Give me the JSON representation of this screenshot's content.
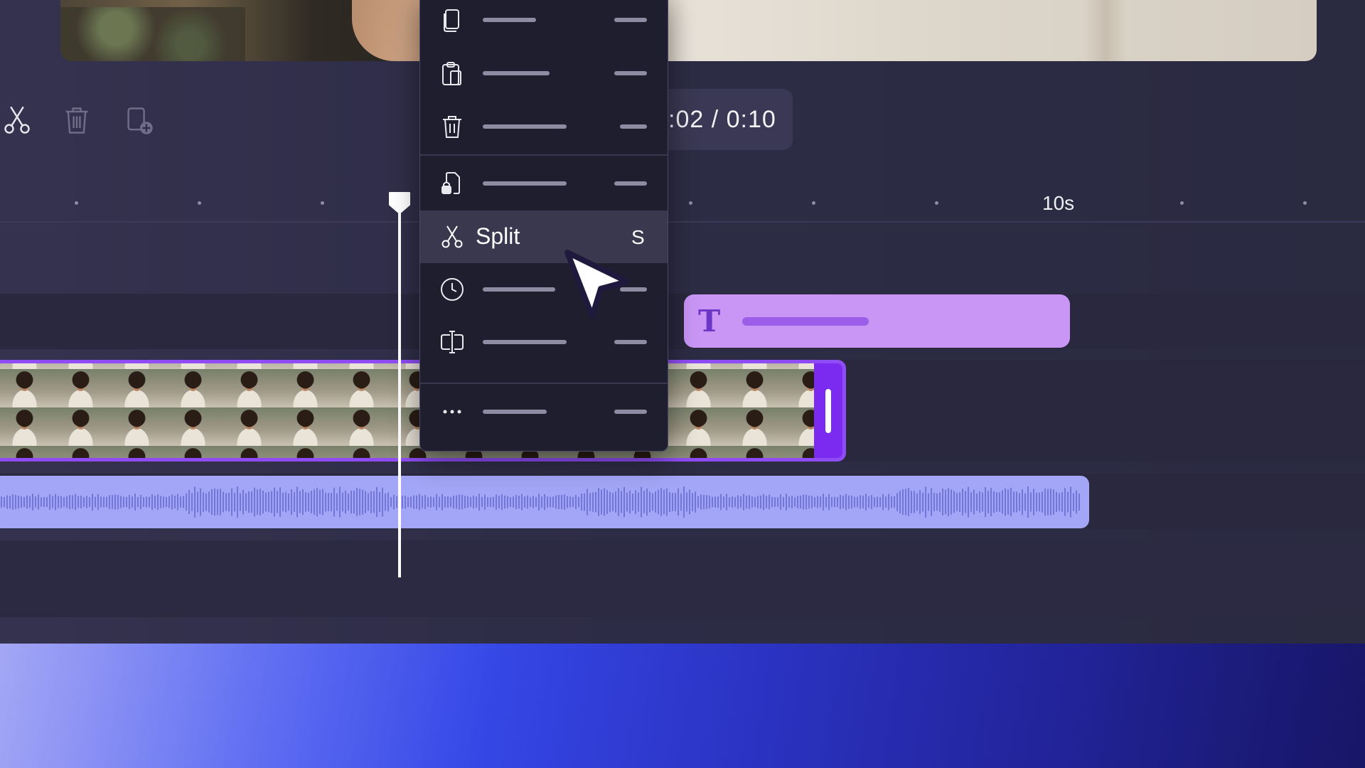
{
  "toolbar": {
    "tools": [
      {
        "name": "split-tool",
        "icon": "scissors-icon"
      },
      {
        "name": "delete-tool",
        "icon": "trash-icon"
      },
      {
        "name": "duplicate-tool",
        "icon": "copy-add-icon"
      }
    ],
    "time_display": ":02 / 0:10"
  },
  "ruler": {
    "label": "10s"
  },
  "timeline": {
    "text_clip_icon": "T",
    "colors": {
      "text_clip": "#c996f5",
      "video_clip_border": "#8f4cf5",
      "audio_clip": "#a3a6f7",
      "playhead": "#ffffff"
    }
  },
  "context_menu": {
    "items": [
      {
        "icon": "copy-icon",
        "label": ""
      },
      {
        "icon": "paste-icon",
        "label": ""
      },
      {
        "icon": "trash-icon",
        "label": ""
      },
      {
        "icon": "lock-icon",
        "label": ""
      },
      {
        "icon": "scissors-icon",
        "label": "Split",
        "shortcut": "S",
        "highlighted": true
      },
      {
        "icon": "clock-icon",
        "label": ""
      },
      {
        "icon": "split-frame-icon",
        "label": ""
      },
      {
        "icon": "more-icon",
        "label": ""
      }
    ]
  }
}
